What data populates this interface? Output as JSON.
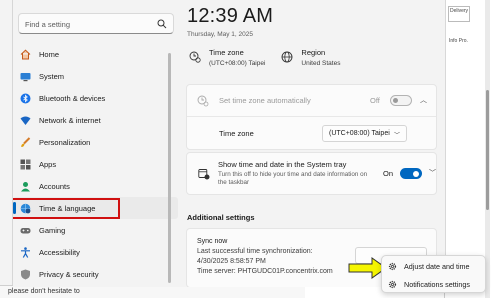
{
  "background": {
    "status_bar_text": "please don't hesitate to",
    "right_cell_1": "Delivery",
    "right_cell_2": "Info Pro."
  },
  "sidebar": {
    "search_placeholder": "Find a setting",
    "items": [
      {
        "label": "Home",
        "icon": "home-icon"
      },
      {
        "label": "System",
        "icon": "system-icon"
      },
      {
        "label": "Bluetooth & devices",
        "icon": "bluetooth-icon"
      },
      {
        "label": "Network & internet",
        "icon": "network-icon"
      },
      {
        "label": "Personalization",
        "icon": "brush-icon"
      },
      {
        "label": "Apps",
        "icon": "apps-icon"
      },
      {
        "label": "Accounts",
        "icon": "account-icon"
      },
      {
        "label": "Time & language",
        "icon": "globe-clock-icon",
        "active": true
      },
      {
        "label": "Gaming",
        "icon": "gamepad-icon"
      },
      {
        "label": "Accessibility",
        "icon": "accessibility-icon"
      },
      {
        "label": "Privacy & security",
        "icon": "shield-icon"
      }
    ]
  },
  "header": {
    "time": "12:39 AM",
    "date": "Thursday, May 1, 2025"
  },
  "timezone": {
    "label": "Time zone",
    "value": "(UTC+08:00) Taipei"
  },
  "region": {
    "label": "Region",
    "value": "United States"
  },
  "auto_tz": {
    "label": "Set time zone automatically",
    "state": "Off"
  },
  "tz_select": {
    "label": "Time zone",
    "value": "(UTC+08:00) Taipei"
  },
  "tray": {
    "title": "Show time and date in the System tray",
    "description": "Turn this off to hide your time and date information on the taskbar",
    "state": "On"
  },
  "additional": {
    "heading": "Additional settings",
    "sync_title": "Sync now",
    "sync_last": "Last successful time synchronization:",
    "sync_time": "4/30/2025 8:58:57 PM",
    "sync_server": "Time server: PHTGUDC01P.concentrix.com"
  },
  "context_menu": {
    "items": [
      {
        "label": "Adjust date and time",
        "icon": "gear-icon"
      },
      {
        "label": "Notifications settings",
        "icon": "gear-icon"
      }
    ]
  },
  "colors": {
    "accent": "#0067c0",
    "highlight_box": "#d01010",
    "arrow_fill": "#f5f500"
  }
}
